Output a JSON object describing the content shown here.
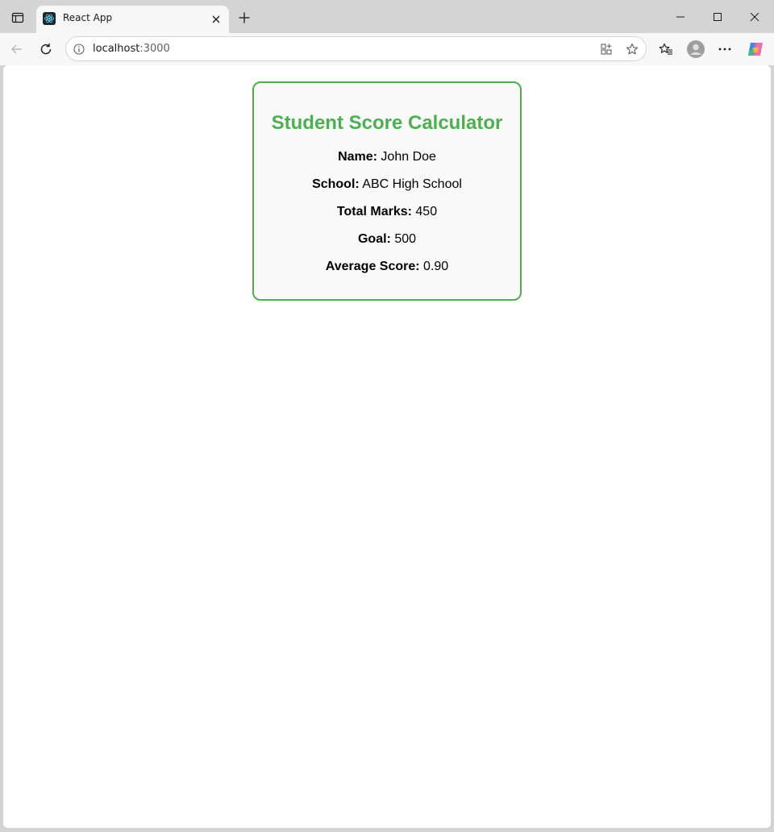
{
  "browser": {
    "tab": {
      "title": "React App",
      "favicon": "react-logo-icon"
    },
    "address_bar": {
      "host": "localhost",
      "port": ":3000"
    },
    "icons": {
      "tab_actions": "tab-actions-icon",
      "close_tab": "close-icon",
      "new_tab": "plus-icon",
      "minimize": "minimize-icon",
      "maximize": "maximize-icon",
      "close_window": "close-icon",
      "back": "back-arrow-icon",
      "reload": "reload-icon",
      "site_info": "info-icon",
      "app_available": "app-install-icon",
      "favorite": "star-icon",
      "favorites": "favorites-icon",
      "profile": "avatar-icon",
      "more": "more-icon",
      "copilot": "copilot-icon"
    }
  },
  "page": {
    "title": "Student Score Calculator",
    "fields": [
      {
        "label": "Name:",
        "value": "John Doe"
      },
      {
        "label": "School:",
        "value": "ABC High School"
      },
      {
        "label": "Total Marks:",
        "value": "450"
      },
      {
        "label": "Goal:",
        "value": "500"
      },
      {
        "label": "Average Score:",
        "value": "0.90"
      }
    ],
    "colors": {
      "accent": "#4caf50",
      "card_background": "#f9f9f9"
    }
  }
}
